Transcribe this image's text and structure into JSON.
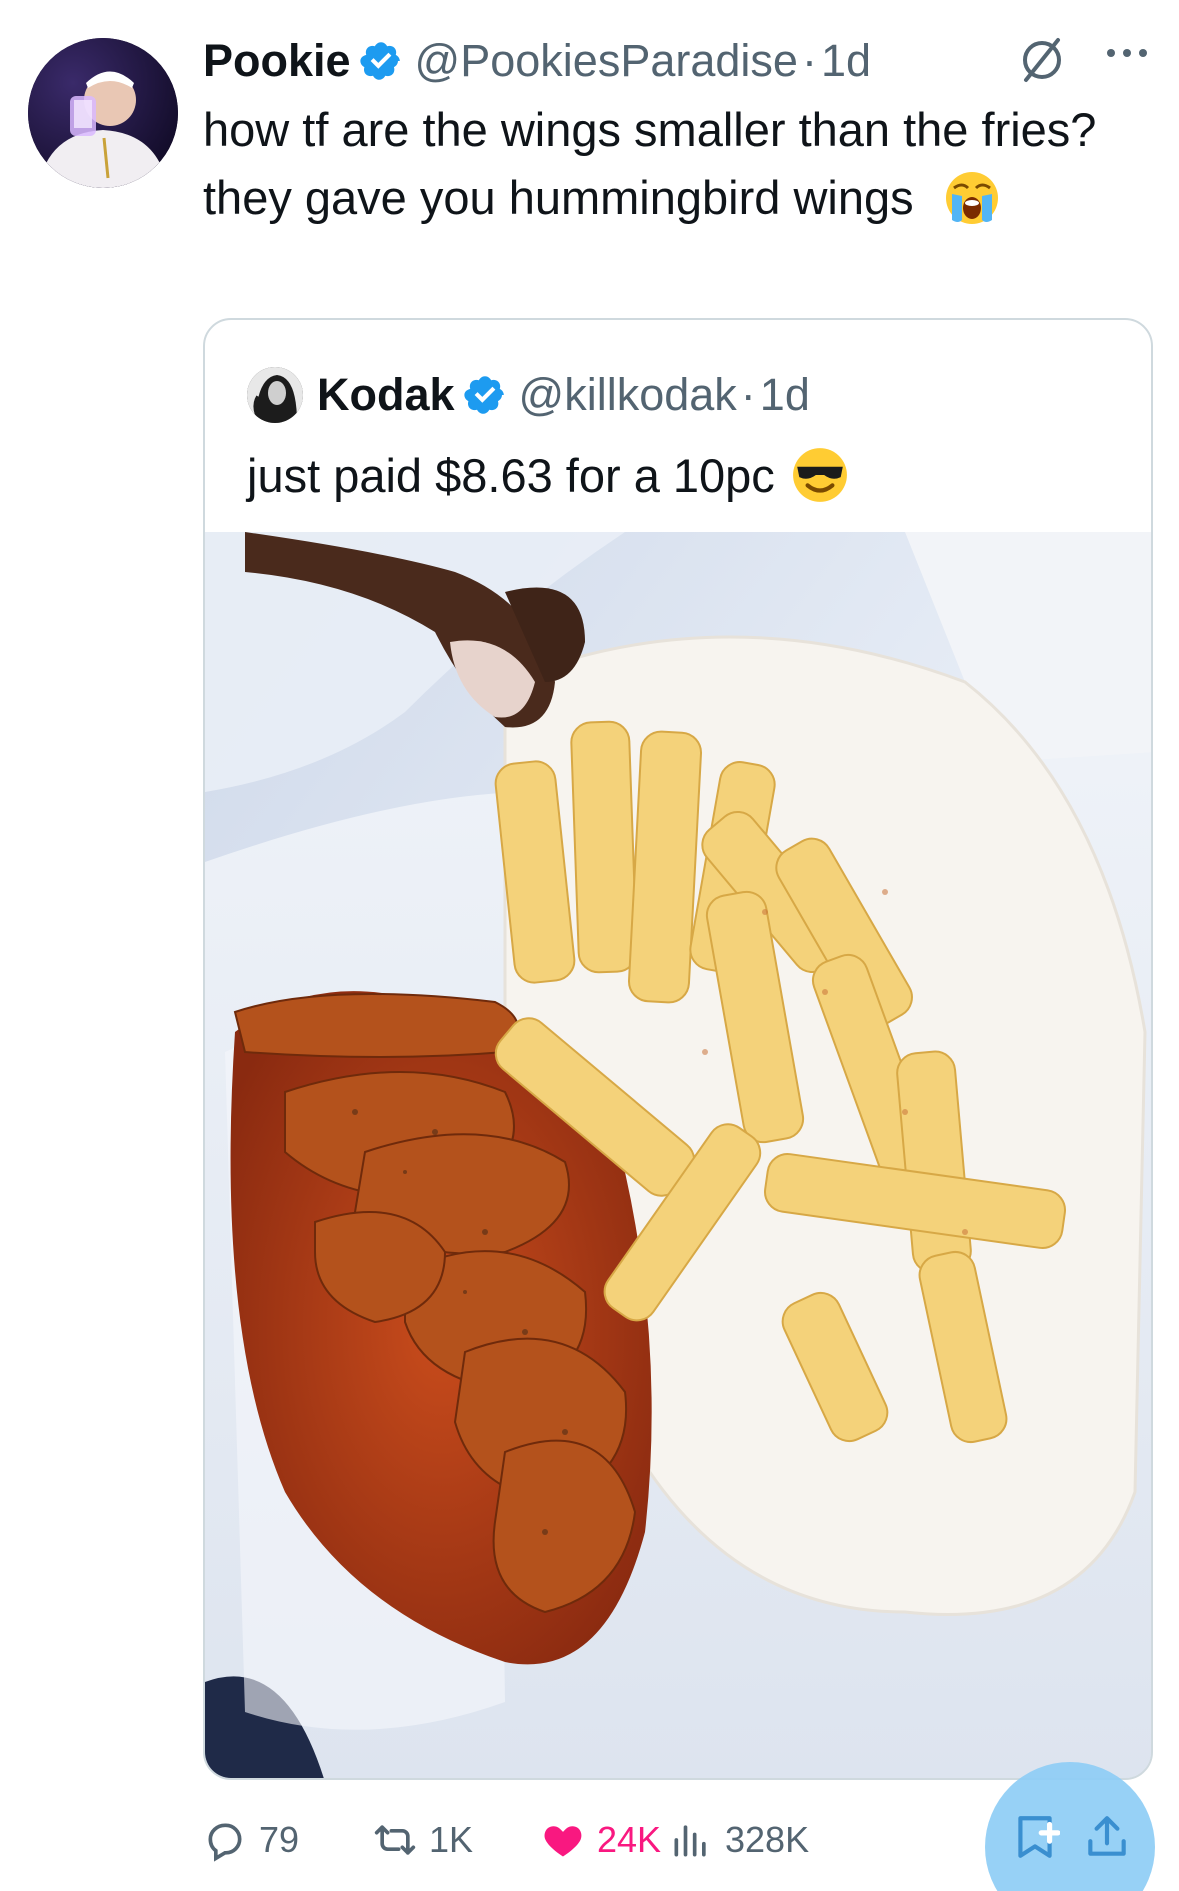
{
  "tweet": {
    "display_name": "Pookie",
    "handle": "@PookiesParadise",
    "separator": "·",
    "time": "1d",
    "text_line1": "how tf are the wings smaller than the fries?",
    "text_line2": "they gave you hummingbird wings",
    "emoji": "loudly-crying-face"
  },
  "quote": {
    "display_name": "Kodak",
    "handle": "@killkodak",
    "separator": "·",
    "time": "1d",
    "text": "just paid $8.63 for a 10pc",
    "emoji": "smiling-face-with-sunglasses"
  },
  "actions": {
    "replies": "79",
    "reposts": "1K",
    "likes": "24K",
    "views": "328K"
  },
  "colors": {
    "verified": "#1d9bf0",
    "like": "#f91880",
    "muted": "#536471",
    "fab": "#8ecdf5"
  }
}
